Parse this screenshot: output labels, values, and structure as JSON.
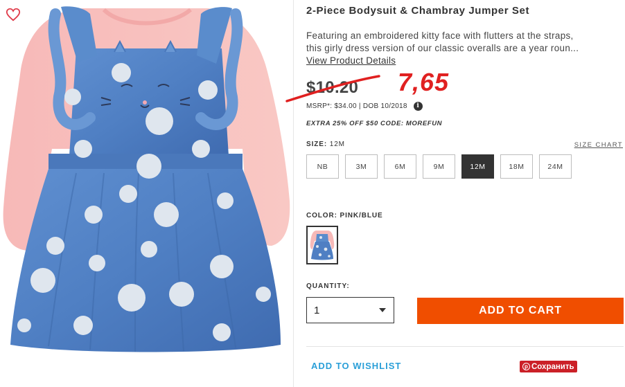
{
  "product": {
    "title": "2-Piece Bodysuit & Chambray Jumper Set",
    "description_line1": "Featuring an embroidered kitty face with flutters at the straps,",
    "description_line2": "this girly dress version of our classic overalls are a year roun...",
    "view_details_label": "View Product Details"
  },
  "price": {
    "current": "$10.20",
    "annotation": "7,65",
    "msrp": "MSRP*: $34.00 | DOB 10/2018",
    "info_icon": "info-icon",
    "promo": "EXTRA 25% OFF $50 CODE: MOREFUN"
  },
  "size": {
    "label": "SIZE:",
    "selected": "12M",
    "chart_label": "SIZE CHART",
    "options": [
      "NB",
      "3M",
      "6M",
      "9M",
      "12M",
      "18M",
      "24M"
    ]
  },
  "color": {
    "label": "COLOR:",
    "selected": "PINK/BLUE"
  },
  "quantity": {
    "label": "QUANTITY:",
    "value": "1"
  },
  "actions": {
    "add_to_cart": "ADD TO CART",
    "add_to_wishlist": "ADD TO WISHLIST",
    "save_pinterest": "Сохранить"
  },
  "colors": {
    "accent_orange": "#f04e00",
    "wishlist_blue": "#2a9fd8",
    "pinterest_red": "#cb2027",
    "annotation_red": "#e02020",
    "heart_red": "#e03b4a"
  }
}
